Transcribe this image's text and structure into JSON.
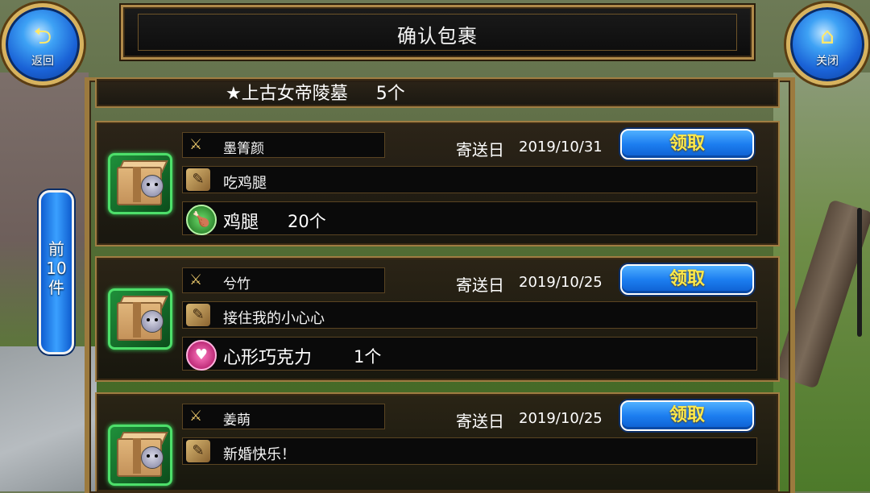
{
  "header": {
    "title": "确认包裹",
    "back_label": "返回",
    "close_label": "关闭",
    "back_icon": "return-arrow-icon",
    "close_icon": "home-icon"
  },
  "prev_button": {
    "line1": "前",
    "line2": "10",
    "line3": "件"
  },
  "partial_item": {
    "name": "★上古女帝陵墓",
    "count": "5个"
  },
  "mail_items": [
    {
      "sender": "墨箐颜",
      "date_label": "寄送日",
      "date": "2019/10/31",
      "claim_label": "领取",
      "message": "吃鸡腿",
      "item_name": "鸡腿",
      "item_count": "20个",
      "item_icon": "chicken-leg-icon"
    },
    {
      "sender": "兮竹",
      "date_label": "寄送日",
      "date": "2019/10/25",
      "claim_label": "领取",
      "message": "接住我的小心心",
      "item_name": "心形巧克力",
      "item_count": "1个",
      "item_icon": "heart-chocolate-icon"
    },
    {
      "sender": "姜萌",
      "date_label": "寄送日",
      "date": "2019/10/25",
      "claim_label": "领取",
      "message": "新婚快乐！"
    }
  ],
  "colors": {
    "accent_gold": "#b08a4a",
    "button_blue": "#1c7ef0",
    "claim_text_yellow": "#ffea4a",
    "icon_green_border": "#4ddf6a"
  }
}
